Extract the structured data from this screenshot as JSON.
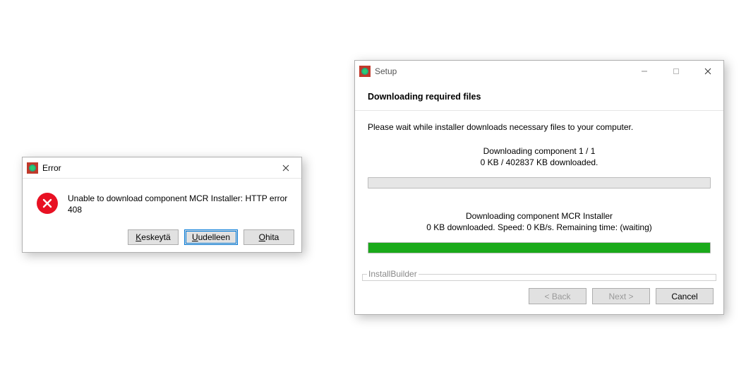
{
  "error": {
    "title": "Error",
    "message": "Unable to download component MCR Installer: HTTP error 408",
    "buttons": {
      "abort": {
        "prefix": "K",
        "rest": "eskeytä"
      },
      "retry": {
        "prefix": "U",
        "rest": "udelleen"
      },
      "ignore": {
        "prefix": "O",
        "rest": "hita"
      }
    }
  },
  "setup": {
    "title": "Setup",
    "heading": "Downloading required files",
    "instruction": "Please wait while installer downloads necessary files to your computer.",
    "overall": {
      "line1": "Downloading component 1 / 1",
      "line2": "0 KB / 402837 KB downloaded.",
      "progress_percent": 0
    },
    "component": {
      "line1": "Downloading component MCR Installer",
      "line2": "0 KB downloaded. Speed: 0 KB/s. Remaining time: (waiting)",
      "progress_percent": 100
    },
    "footer_brand": "InstallBuilder",
    "buttons": {
      "back": "< Back",
      "next": "Next >",
      "cancel": "Cancel"
    }
  },
  "colors": {
    "accent": "#0078d7",
    "error_red": "#e81123",
    "progress_green": "#1aaa1a"
  }
}
